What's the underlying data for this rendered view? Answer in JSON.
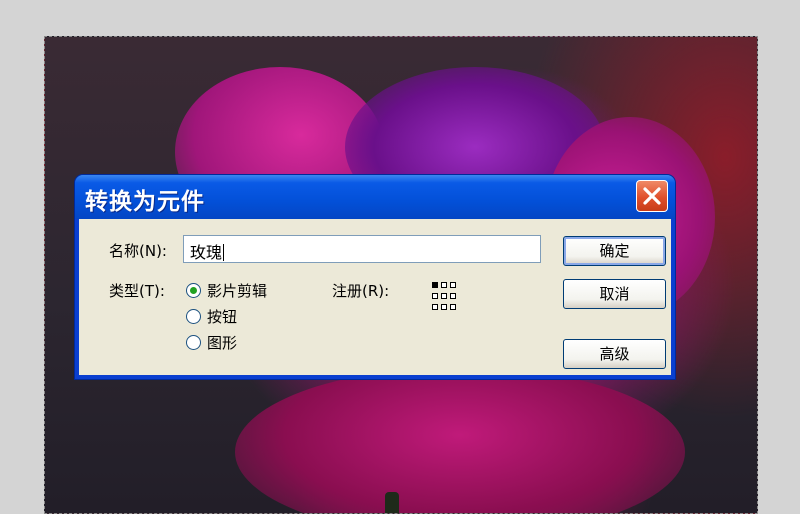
{
  "dialog": {
    "title": "转换为元件",
    "name_label": "名称(N):",
    "name_value": "玫瑰",
    "type_label": "类型(T):",
    "type_options": [
      {
        "label": "影片剪辑",
        "selected": true
      },
      {
        "label": "按钮",
        "selected": false
      },
      {
        "label": "图形",
        "selected": false
      }
    ],
    "registration_label": "注册(R):",
    "registration_point": "top-left",
    "ok_label": "确定",
    "cancel_label": "取消",
    "advanced_label": "高级"
  },
  "colors": {
    "title_bar": "#0a5ae6",
    "dialog_bg": "#ece9d8",
    "close_button": "#e0502c",
    "radio_dot": "#21a121"
  },
  "icons": {
    "close": "close-x-icon",
    "registration": "registration-grid-icon"
  }
}
